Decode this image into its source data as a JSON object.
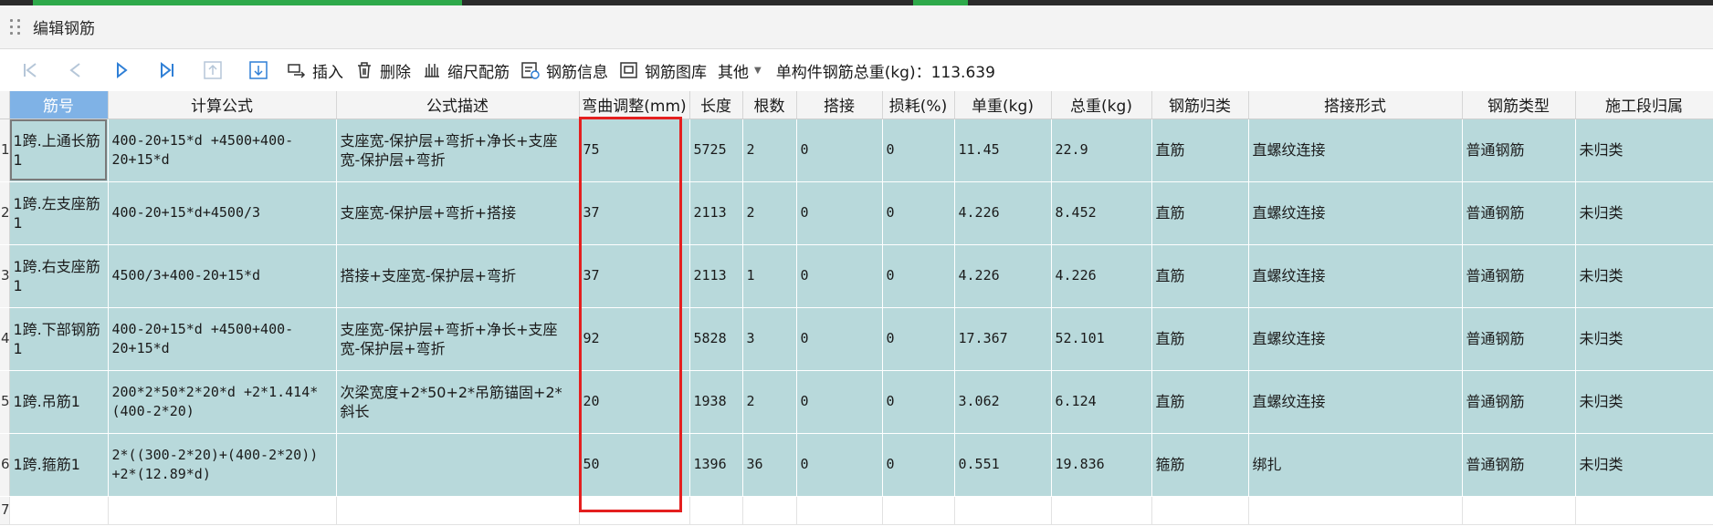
{
  "window": {
    "title": "编辑钢筋"
  },
  "toolbar": {
    "insert_label": "插入",
    "delete_label": "删除",
    "scale_label": "缩尺配筋",
    "info_label": "钢筋信息",
    "library_label": "钢筋图库",
    "other_label": "其他",
    "total_label": "单构件钢筋总重(kg)：113.639"
  },
  "columns": {
    "c1": "筋号",
    "c2": "计算公式",
    "c3": "公式描述",
    "c4": "弯曲调整(mm)",
    "c5": "长度",
    "c6": "根数",
    "c7": "搭接",
    "c8": "损耗(%)",
    "c9": "单重(kg)",
    "c10": "总重(kg)",
    "c11": "钢筋归类",
    "c12": "搭接形式",
    "c13": "钢筋类型",
    "c14": "施工段归属"
  },
  "rows": [
    {
      "n": "1",
      "name": "1跨.上通长筋1",
      "formula": "400-20+15*d +4500+400-20+15*d",
      "desc": "支座宽-保护层+弯折+净长+支座宽-保护层+弯折",
      "bend": "75",
      "len": "5725",
      "cnt": "2",
      "lap": "0",
      "loss": "0",
      "unit": "11.45",
      "total": "22.9",
      "cls": "直筋",
      "lapform": "直螺纹连接",
      "type": "普通钢筋",
      "seg": "未归类"
    },
    {
      "n": "2",
      "name": "1跨.左支座筋1",
      "formula": "400-20+15*d+4500/3",
      "desc": "支座宽-保护层+弯折+搭接",
      "bend": "37",
      "len": "2113",
      "cnt": "2",
      "lap": "0",
      "loss": "0",
      "unit": "4.226",
      "total": "8.452",
      "cls": "直筋",
      "lapform": "直螺纹连接",
      "type": "普通钢筋",
      "seg": "未归类"
    },
    {
      "n": "3",
      "name": "1跨.右支座筋1",
      "formula": "4500/3+400-20+15*d",
      "desc": "搭接+支座宽-保护层+弯折",
      "bend": "37",
      "len": "2113",
      "cnt": "1",
      "lap": "0",
      "loss": "0",
      "unit": "4.226",
      "total": "4.226",
      "cls": "直筋",
      "lapform": "直螺纹连接",
      "type": "普通钢筋",
      "seg": "未归类"
    },
    {
      "n": "4",
      "name": "1跨.下部钢筋1",
      "formula": "400-20+15*d +4500+400-20+15*d",
      "desc": "支座宽-保护层+弯折+净长+支座宽-保护层+弯折",
      "bend": "92",
      "len": "5828",
      "cnt": "3",
      "lap": "0",
      "loss": "0",
      "unit": "17.367",
      "total": "52.101",
      "cls": "直筋",
      "lapform": "直螺纹连接",
      "type": "普通钢筋",
      "seg": "未归类"
    },
    {
      "n": "5",
      "name": "1跨.吊筋1",
      "formula": "200*2*50*2*20*d +2*1.414*(400-2*20)",
      "desc": "次梁宽度+2*50+2*吊筋锚固+2*斜长",
      "bend": "20",
      "len": "1938",
      "cnt": "2",
      "lap": "0",
      "loss": "0",
      "unit": "3.062",
      "total": "6.124",
      "cls": "直筋",
      "lapform": "直螺纹连接",
      "type": "普通钢筋",
      "seg": "未归类"
    },
    {
      "n": "6",
      "name": "1跨.箍筋1",
      "formula": "2*((300-2*20)+(400-2*20)) +2*(12.89*d)",
      "desc": "",
      "bend": "50",
      "len": "1396",
      "cnt": "36",
      "lap": "0",
      "loss": "0",
      "unit": "0.551",
      "total": "19.836",
      "cls": "箍筋",
      "lapform": "绑扎",
      "type": "普通钢筋",
      "seg": "未归类"
    }
  ],
  "empty_row": {
    "n": "7"
  }
}
